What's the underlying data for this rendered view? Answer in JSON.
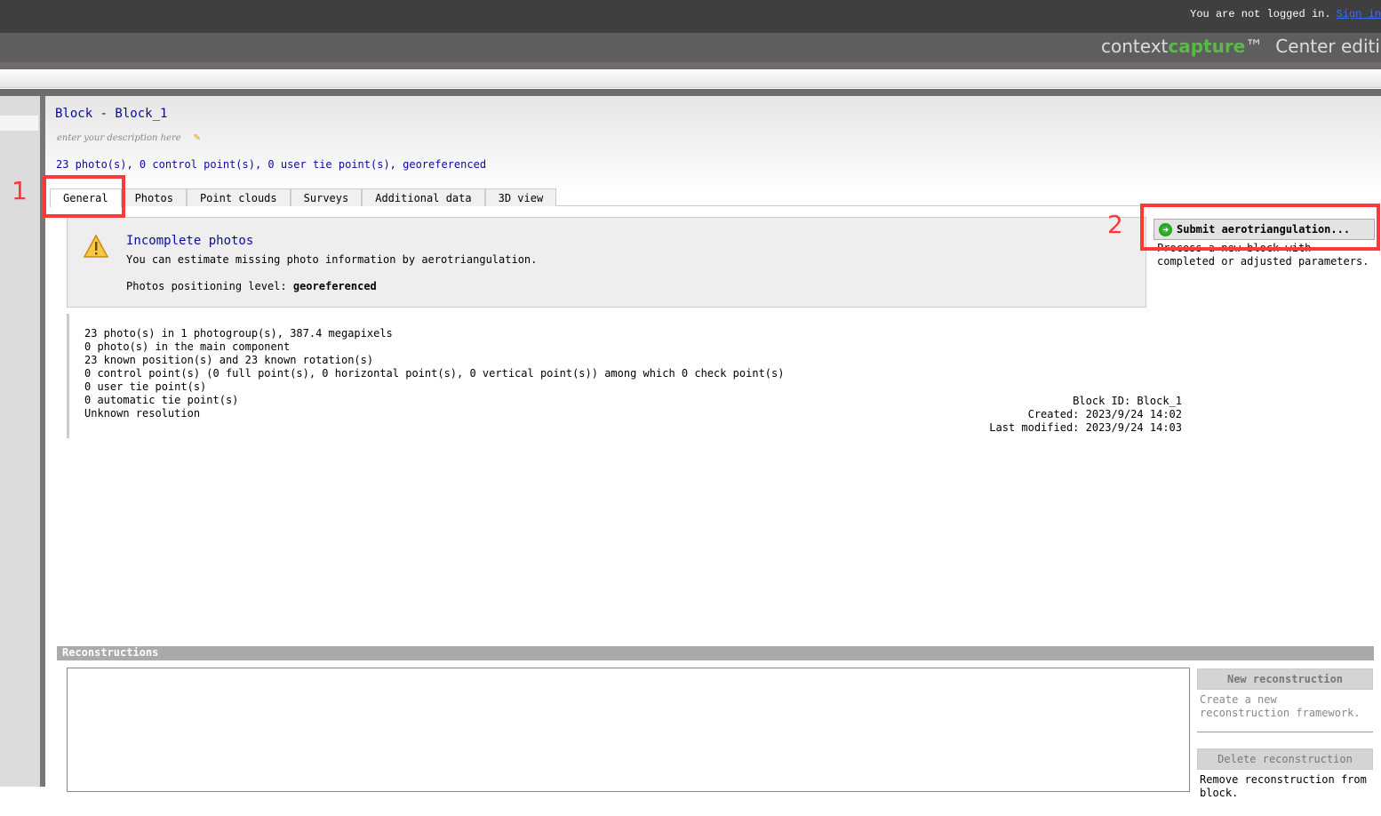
{
  "topbar": {
    "login_text": "You are not logged in.",
    "sign_in_link": "Sign in"
  },
  "brand": {
    "prefix": "context",
    "highlight": "capture",
    "tm": "™",
    "edition": "Center edition",
    "accent_color": "#5cb84a"
  },
  "block": {
    "title": "Block - Block_1",
    "description_placeholder": "enter your description here",
    "summary": "23 photo(s), 0 control point(s), 0 user tie point(s), georeferenced"
  },
  "tabs": [
    {
      "label": "General",
      "active": true
    },
    {
      "label": "Photos"
    },
    {
      "label": "Point clouds"
    },
    {
      "label": "Surveys"
    },
    {
      "label": "Additional data"
    },
    {
      "label": "3D view"
    }
  ],
  "warning": {
    "icon": "warning-icon",
    "title": "Incomplete photos",
    "text": "You can estimate missing photo information by aerotriangulation.",
    "level_label": "Photos positioning level:",
    "level_value": "georeferenced"
  },
  "submit": {
    "label": "Submit aerotriangulation...",
    "description": "Process a new block with completed or adjusted parameters.",
    "icon": "arrow-right-circle-icon"
  },
  "stats": [
    "23 photo(s) in 1 photogroup(s), 387.4 megapixels",
    "0 photo(s) in the main component",
    "23 known position(s) and 23 known rotation(s)",
    "0 control point(s) (0 full point(s), 0 horizontal point(s), 0 vertical point(s)) among which 0 check point(s)",
    "0 user tie point(s)",
    "0 automatic tie point(s)",
    "Unknown resolution"
  ],
  "meta": {
    "block_id": "Block ID: Block_1",
    "created": "Created: 2023/9/24 14:02",
    "modified": "Last modified: 2023/9/24 14:03"
  },
  "reconstructions": {
    "heading": "Reconstructions",
    "new_label": "New reconstruction",
    "new_desc": "Create a new reconstruction framework.",
    "delete_label": "Delete reconstruction",
    "delete_desc": "Remove reconstruction from block."
  },
  "annotations": {
    "one": "1",
    "two": "2",
    "color": "#ff3838"
  }
}
